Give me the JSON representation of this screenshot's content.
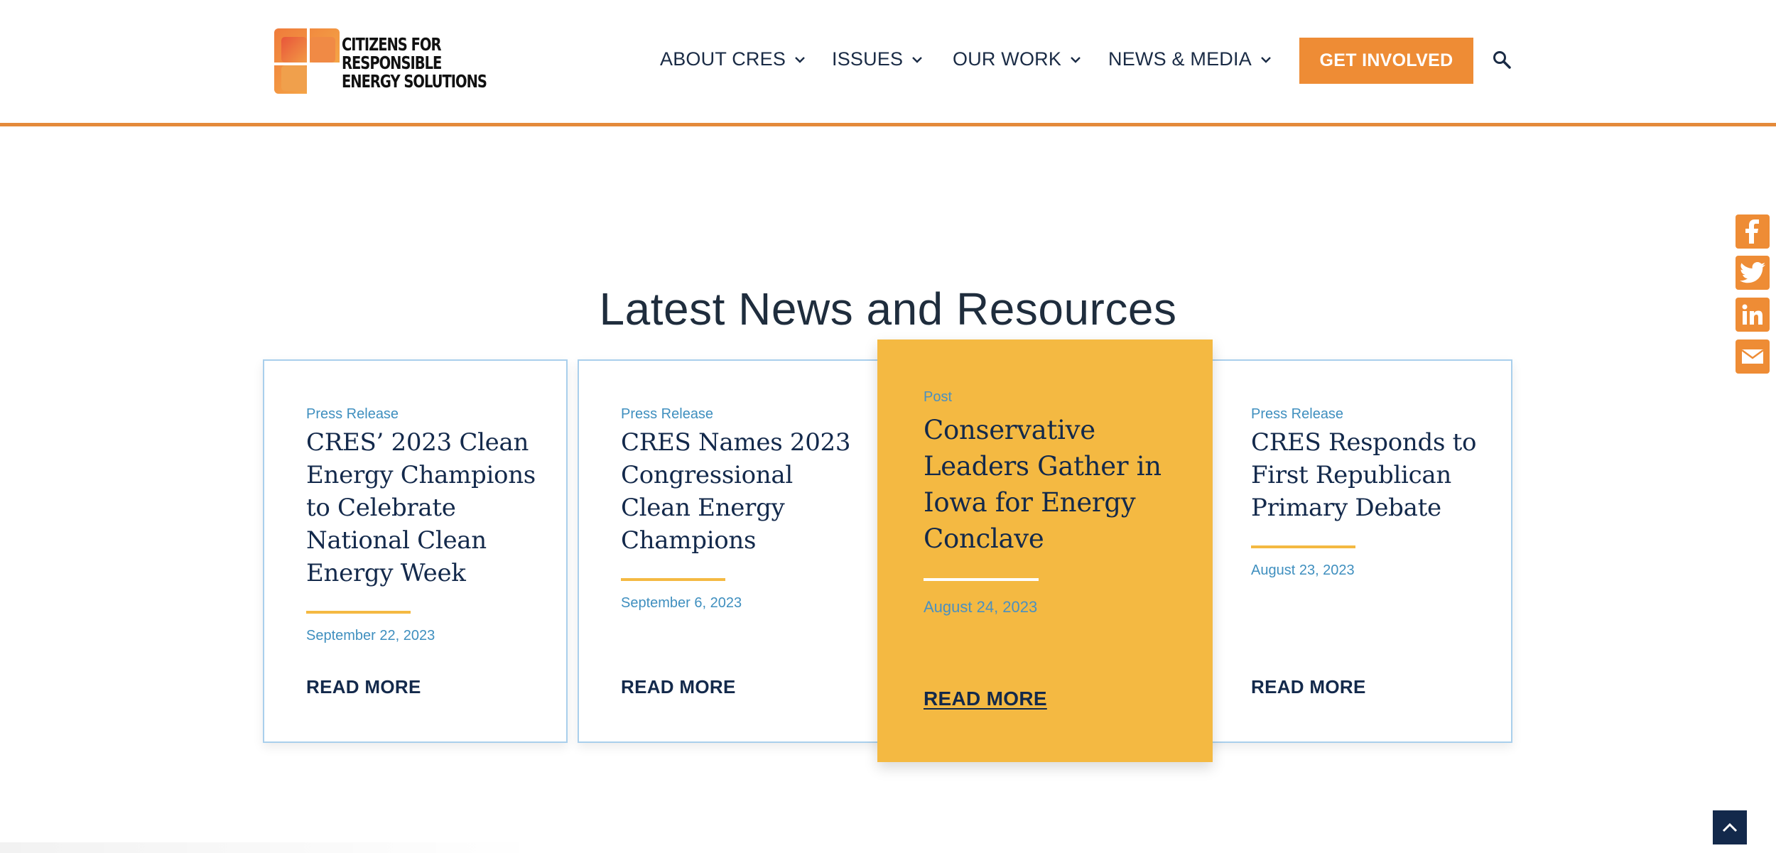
{
  "brand": {
    "line1": "CITIZENS FOR",
    "line2": "RESPONSIBLE",
    "line3": "ENERGY SOLUTIONS",
    "colors": {
      "orange": "#ee8c35",
      "gold": "#f4b942",
      "navy": "#13294b",
      "blue": "#3f8fbf"
    }
  },
  "nav": {
    "items": [
      {
        "label": "ABOUT CRES"
      },
      {
        "label": "ISSUES"
      },
      {
        "label": "OUR WORK"
      },
      {
        "label": "NEWS & MEDIA"
      }
    ],
    "cta_label": "GET INVOLVED",
    "search_icon": "search-icon"
  },
  "section": {
    "title": "Latest News and Resources"
  },
  "cards": [
    {
      "category": "Press Release",
      "title_lines": [
        "CRES’ 2023 Clean",
        "Energy Champions",
        "to Celebrate",
        "National Clean",
        "Energy Week"
      ],
      "date": "September 22, 2023",
      "read_more": "READ MORE"
    },
    {
      "category": "Press Release",
      "title_lines": [
        "CRES Names 2023",
        "Congressional",
        "Clean Energy",
        "Champions"
      ],
      "date": "September 6, 2023",
      "read_more": "READ MORE"
    },
    {
      "category": "Post",
      "title_lines": [
        "Conservative",
        "Leaders Gather in",
        "Iowa for Energy",
        "Conclave"
      ],
      "date": "August 24, 2023",
      "read_more": "READ MORE"
    },
    {
      "category": "Press Release",
      "title_lines": [
        "CRES Responds to",
        "First Republican",
        "Primary Debate"
      ],
      "date": "August 23, 2023",
      "read_more": "READ MORE"
    }
  ],
  "share": [
    "facebook-icon",
    "twitter-icon",
    "linkedin-icon",
    "email-icon"
  ],
  "back_to_top_icon": "chevron-up-icon"
}
